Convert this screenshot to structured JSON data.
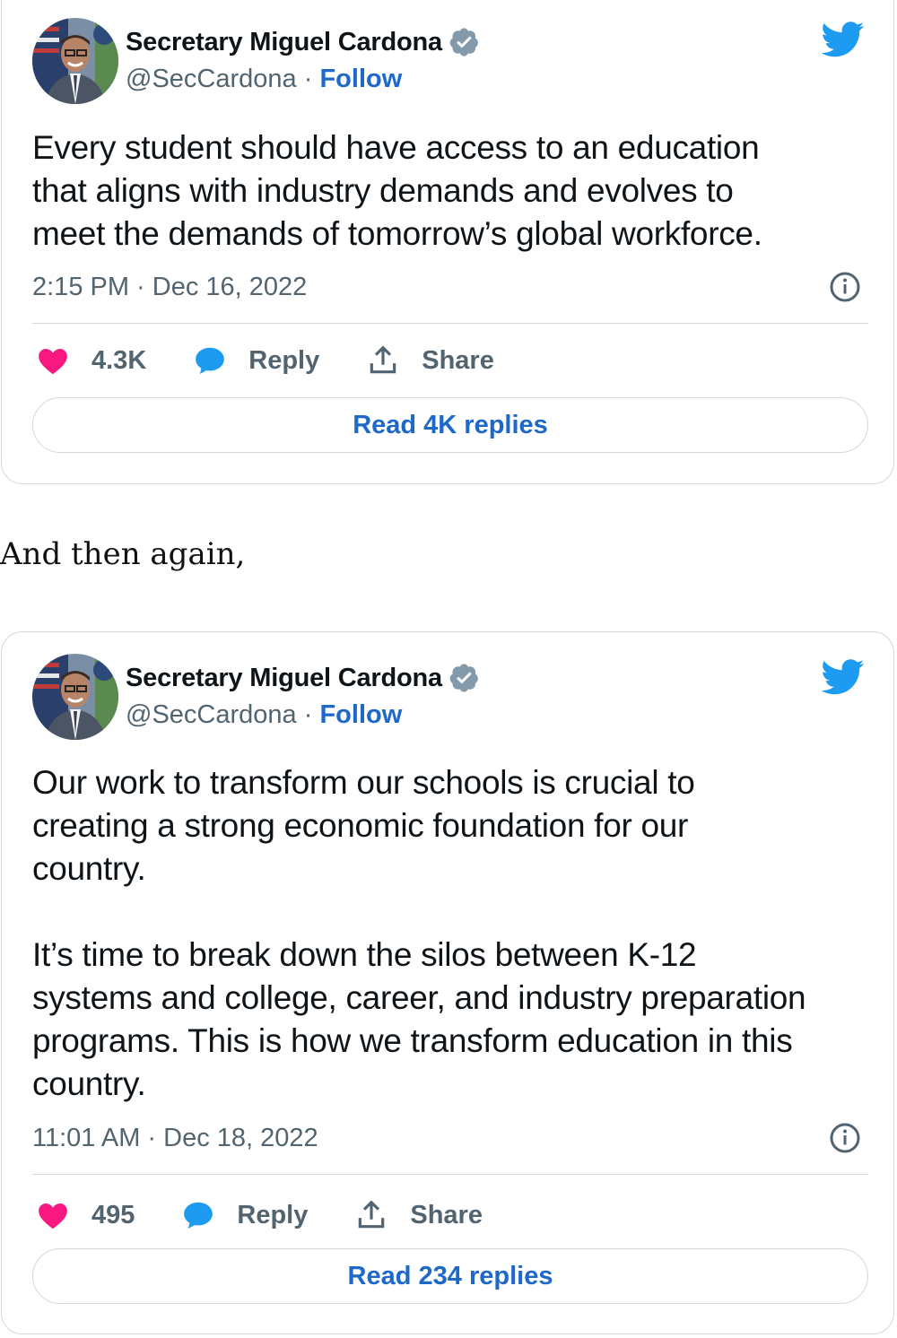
{
  "colors": {
    "link_blue": "#1d68c8",
    "muted_gray": "#536471",
    "border": "#cfd9de",
    "heart_pink": "#f91880",
    "reply_blue": "#1d9bf0",
    "twitter_blue": "#1d9bf0"
  },
  "icons": {
    "brand": "twitter-bird-icon",
    "verified": "verified-badge-icon",
    "info": "info-circle-icon",
    "like": "heart-icon",
    "reply": "speech-bubble-icon",
    "share": "share-upload-icon"
  },
  "between_text": "And then again,",
  "tweets": [
    {
      "author": {
        "name": "Secretary Miguel Cardona",
        "handle": "@SecCardona",
        "separator": "·",
        "follow": "Follow"
      },
      "text": "Every student should have access to an education\nthat aligns with industry demands and evolves to\nmeet the demands of tomorrow’s global workforce.",
      "timestamp": "2:15 PM · Dec 16, 2022",
      "likes": "4.3K",
      "reply_label": "Reply",
      "share_label": "Share",
      "read_replies": "Read 4K replies"
    },
    {
      "author": {
        "name": "Secretary Miguel Cardona",
        "handle": "@SecCardona",
        "separator": "·",
        "follow": "Follow"
      },
      "text": "Our work to transform our schools is crucial to\ncreating a strong economic foundation for our\ncountry.\n\nIt’s time to break down the silos between K-12\nsystems and college, career, and industry preparation\nprograms. This is how we transform education in this\ncountry.",
      "timestamp": "11:01 AM · Dec 18, 2022",
      "likes": "495",
      "reply_label": "Reply",
      "share_label": "Share",
      "read_replies": "Read 234 replies"
    }
  ]
}
